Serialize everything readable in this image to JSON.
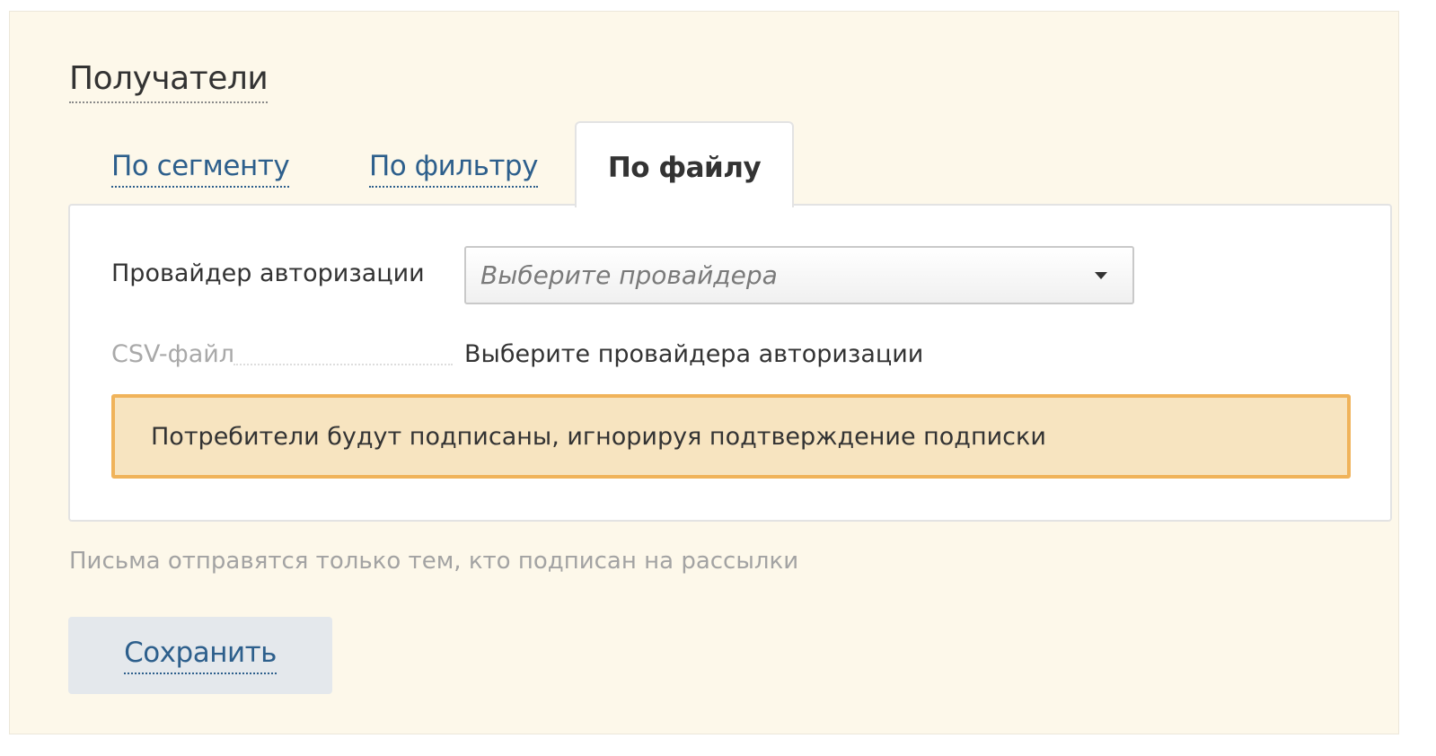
{
  "recipients": {
    "title": "Получатели",
    "tabs": [
      {
        "label": "По сегменту",
        "active": false
      },
      {
        "label": "По фильтру",
        "active": false
      },
      {
        "label": "По файлу",
        "active": true
      }
    ],
    "provider_field": {
      "label": "Провайдер авторизации",
      "placeholder": "Выберите провайдера"
    },
    "csv_field": {
      "label": "CSV-файл",
      "value": "Выберите провайдера авторизации"
    },
    "warning": {
      "text": "Потребители будут подписаны, игнорируя подтверждение подписки"
    },
    "hint": "Письма отправятся только тем, кто подписан на рассылки",
    "save_label": "Сохранить"
  },
  "colors": {
    "panel_bg": "#fdf8ea",
    "link": "#2d5f8c",
    "warning_bg": "#f7e4c0",
    "warning_border": "#f0b35a",
    "button_bg": "#e4e8ec"
  }
}
